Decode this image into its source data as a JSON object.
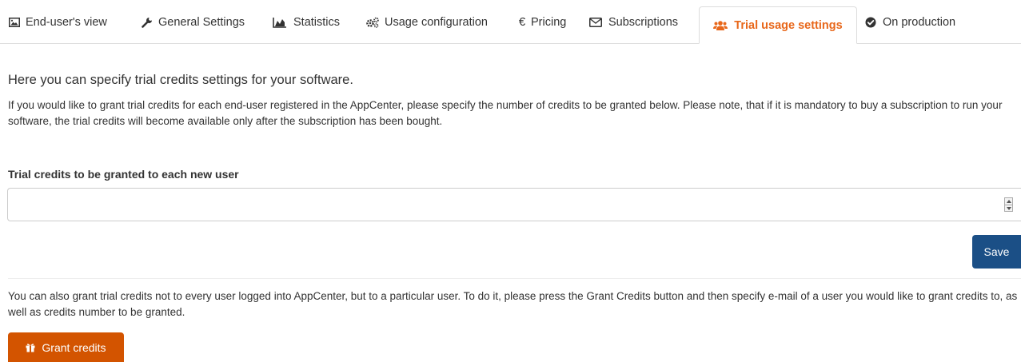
{
  "tabs": [
    {
      "label": "End-user's view",
      "icon": "image-icon"
    },
    {
      "label": "General Settings",
      "icon": "wrench-icon"
    },
    {
      "label": "Statistics",
      "icon": "area-chart-icon"
    },
    {
      "label": "Usage configuration",
      "icon": "cogs-icon"
    },
    {
      "label": "Pricing",
      "icon": "euro-icon"
    },
    {
      "label": "Subscriptions",
      "icon": "envelope-icon"
    },
    {
      "label": "Trial usage settings",
      "icon": "users-icon",
      "active": true
    },
    {
      "label": "On production",
      "icon": "check-circle-icon"
    }
  ],
  "main": {
    "lead": "Here you can specify trial credits settings for your software.",
    "intro": "If you would like to grant trial credits for each end-user registered in the AppCenter, please specify the number of credits to be granted below. Please note, that if it is mandatory to buy a subscription to run your software, the trial credits will become available only after the subscription has been bought.",
    "field_label": "Trial credits to be granted to each new user",
    "field_value": "",
    "save_label": "Save",
    "grant_text": "You can also grant trial credits not to every user logged into AppCenter, but to a particular user. To do it, please press the Grant Credits button and then specify e-mail of a user you would like to grant credits to, as well as credits number to be granted.",
    "grant_label": "Grant credits"
  },
  "colors": {
    "accent": "#e8671a",
    "save_button": "#1b4f86",
    "grant_button": "#d35400"
  }
}
